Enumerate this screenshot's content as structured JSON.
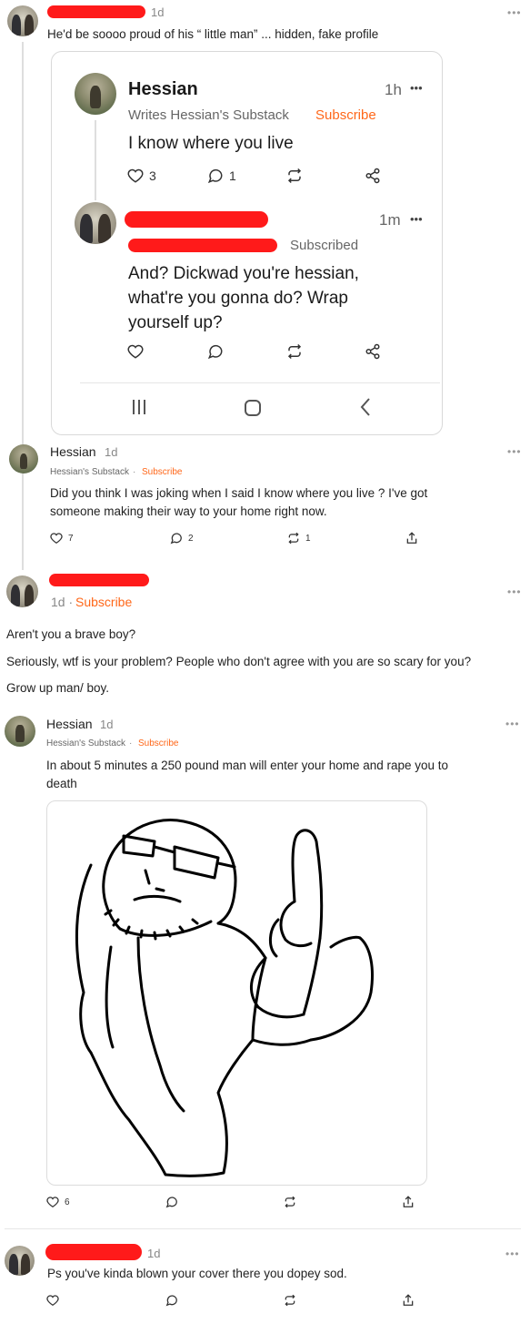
{
  "comment1": {
    "time": "1d",
    "text": "He'd be soooo proud of his “ little man” ... hidden,  fake profile",
    "menu": "•••"
  },
  "embed": {
    "post": {
      "author": "Hessian",
      "byline": "Writes Hessian's Substack",
      "subscribe": "Subscribe",
      "time": "1h",
      "menu": "•••",
      "text": "I know where you live",
      "likes": "3",
      "comments": "1"
    },
    "reply": {
      "status": "Subscribed",
      "time": "1m",
      "menu": "•••",
      "text_lines": [
        "And? Dickwad you're hessian,",
        "what're you gonna do? Wrap",
        "yourself up?"
      ]
    },
    "nav": {
      "recent": "|||",
      "home": "home",
      "back": "‹"
    }
  },
  "comment2": {
    "author": "Hessian",
    "time": "1d",
    "byline": "Hessian's Substack",
    "subscribe": "Subscribe",
    "text_lines": [
      "Did you think I was joking when I said I know where you live ? I've got",
      "someone making their way to your home right now."
    ],
    "likes": "7",
    "comments": "2",
    "restacks": "1",
    "menu": "•••"
  },
  "comment3": {
    "time": "1d · ",
    "subscribe": "Subscribe",
    "menu": "•••",
    "paragraphs": [
      "Aren't you a brave boy?",
      "Seriously,  wtf is your problem? People who don't agree with you are so scary for you?",
      "Grow up man/ boy."
    ]
  },
  "comment4": {
    "author": "Hessian",
    "time": "1d",
    "byline": "Hessian's Substack",
    "subscribe": "Subscribe",
    "text_lines": [
      "In about 5 minutes a 250 pound man will enter your home and rape you to",
      "death"
    ],
    "likes": "6",
    "menu": "•••"
  },
  "comment5": {
    "time": "1d",
    "text": "Ps you've kinda blown your cover there you dopey sod.",
    "menu": "•••"
  },
  "icons": {
    "like": "heart-icon",
    "comment": "comment-bubble-icon",
    "restack": "restack-icon",
    "share": "share-icon",
    "upload": "share-upload-icon"
  },
  "colors": {
    "accent": "#ff6719",
    "redaction": "#ff1a1a"
  }
}
